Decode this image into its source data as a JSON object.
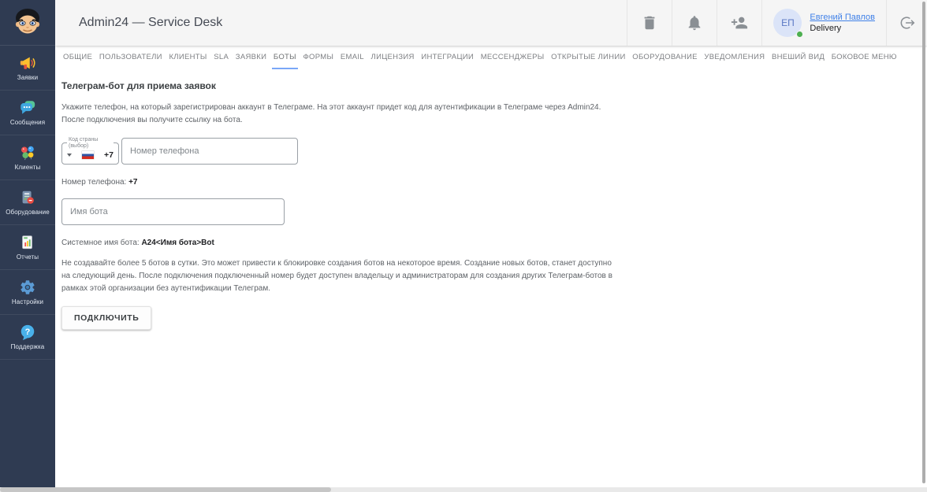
{
  "header": {
    "title": "Admin24 — Service Desk",
    "icons": [
      "trash-icon",
      "bell-icon",
      "person-add-icon",
      "logout-icon"
    ],
    "user": {
      "initials": "ЕП",
      "name": "Евгений Павлов",
      "subtitle": "Delivery"
    }
  },
  "sidebar": {
    "items": [
      {
        "label": "Заявки",
        "icon": "megaphone-icon"
      },
      {
        "label": "Сообщения",
        "icon": "chat-icon"
      },
      {
        "label": "Клиенты",
        "icon": "clients-icon"
      },
      {
        "label": "Оборудование",
        "icon": "equipment-icon"
      },
      {
        "label": "Отчеты",
        "icon": "report-icon"
      },
      {
        "label": "Настройки",
        "icon": "gear-icon"
      },
      {
        "label": "Поддержка",
        "icon": "help-icon"
      }
    ]
  },
  "tabs": {
    "active": "БОТЫ",
    "items": [
      "ОБЩИЕ",
      "ПОЛЬЗОВАТЕЛИ",
      "КЛИЕНТЫ",
      "SLA",
      "ЗАЯВКИ",
      "БОТЫ",
      "ФОРМЫ",
      "EMAIL",
      "ЛИЦЕНЗИЯ",
      "ИНТЕГРАЦИИ",
      "МЕССЕНДЖЕРЫ",
      "ОТКРЫТЫЕ ЛИНИИ",
      "ОБОРУДОВАНИЕ",
      "УВЕДОМЛЕНИЯ",
      "ВНЕШИЙ ВИД",
      "БОКОВОЕ МЕНЮ"
    ]
  },
  "content": {
    "heading": "Телеграм-бот для приема заявок",
    "intro_lines": [
      "Укажите телефон, на который зарегистрирован аккаунт в Телеграме. На этот аккаунт придет код для аутентификации в Телеграме через Admin24.",
      "После подключения вы получите ссылку на бота."
    ],
    "country_field": {
      "legend": "Код страны (выбор)",
      "code": "+7",
      "flag": "russia-flag"
    },
    "phone_input": {
      "placeholder": "Номер телефона"
    },
    "phone_summary": {
      "label": "Номер телефона:",
      "value": "+7"
    },
    "bot_name_input": {
      "placeholder": "Имя бота"
    },
    "system_name": {
      "label": "Системное имя бота:",
      "value": "A24<Имя бота>Bot"
    },
    "warning_lines": [
      "Не создавайте более 5 ботов в сутки. Это может привести к блокировке создания ботов на некоторое время. Создание новых ботов, станет доступно",
      "на следующий день. После подключения подключенный номер будет доступен владельцу и администраторам для создания других Телеграм-ботов в",
      "рамках этой организации без аутентификации Телеграм."
    ],
    "connect_button": "ПОДКЛЮЧИТЬ"
  },
  "colors": {
    "sidebar_bg": "#2f3b52",
    "header_bg": "#f5f5f5",
    "accent_underline": "#7aa7f8",
    "link_blue": "#4081e8",
    "status_green": "#4caf50"
  }
}
